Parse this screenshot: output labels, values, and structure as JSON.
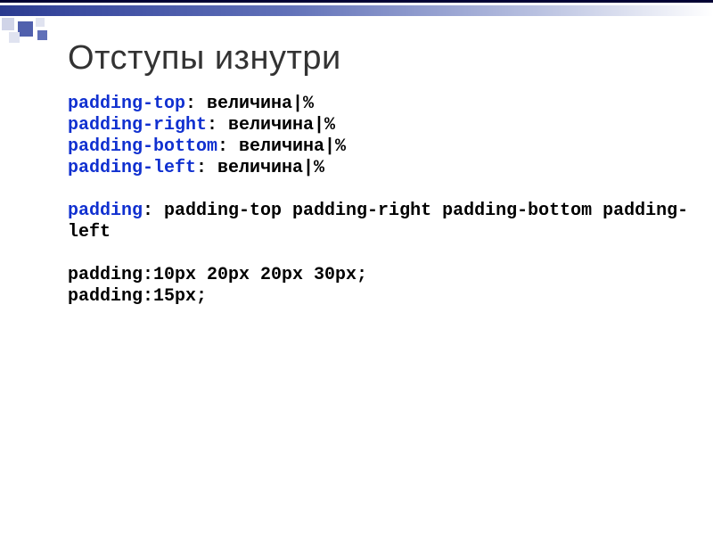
{
  "title": "Отступы изнутри",
  "code": {
    "line1": {
      "kw": "padding-top",
      "rest": ": величина|%"
    },
    "line2": {
      "kw": "padding-right",
      "rest": ": величина|%"
    },
    "line3": {
      "kw": "padding-bottom",
      "rest": ": величина|%"
    },
    "line4": {
      "kw": "padding-left",
      "rest": ": величина|%"
    },
    "line5": {
      "kw": "padding",
      "rest": ": padding-top padding-right padding-bottom padding-left"
    },
    "line6": "padding:10px 20px 20px 30px;",
    "line7": "padding:15px;"
  }
}
